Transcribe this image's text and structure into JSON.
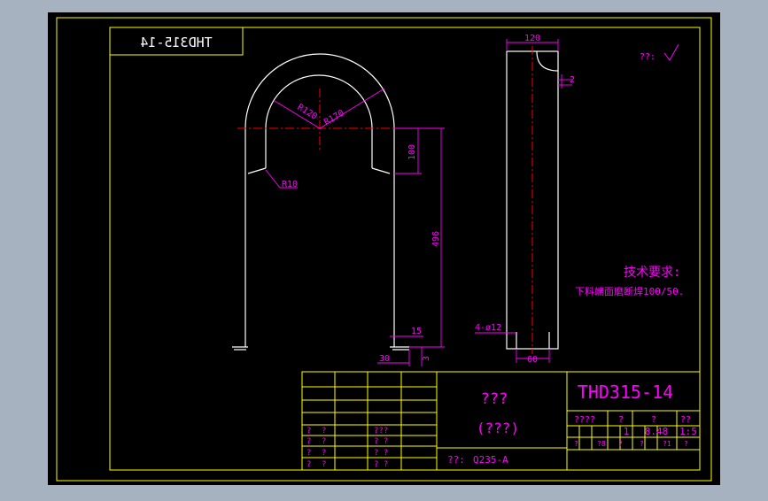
{
  "colors": {
    "background": "#a6b2c0",
    "canvas": "#000000",
    "frame": "#ffff00",
    "part_line": "#ffffff",
    "dimension": "#ff00ff",
    "centerline": "#ff0000"
  },
  "drawing": {
    "mirrored_code": "THD315-14",
    "roughness_symbol": "??:",
    "dimensions": {
      "r120": "R120",
      "r170": "R170",
      "r10": "R10",
      "d100": "100",
      "d496": "496",
      "d15": "15",
      "d30": "30",
      "d3": "3",
      "d120": "120",
      "d2": "2",
      "d60": "60",
      "holes": "4-ø12"
    },
    "notes_title": "技术要求:",
    "notes_text": "下料端面磨断焊100/50."
  },
  "title_block": {
    "part_name": "???",
    "part_subtitle": "(???)",
    "drawing_number": "THD315-14",
    "material_label": "??:",
    "material_value": "Q235-A",
    "left_rows": [
      [
        "?",
        "?",
        "?",
        "?",
        "?"
      ],
      [
        "?",
        "?",
        "?",
        "?",
        "?"
      ],
      [
        "?",
        "?",
        "?",
        "?",
        "?"
      ],
      [
        "?",
        "?",
        "?",
        "?",
        "?"
      ]
    ],
    "left_row_texts": [
      {
        "a": "?",
        "b": "?",
        "c": "???"
      },
      {
        "a": "?",
        "b": "?",
        "c": "? ?"
      },
      {
        "a": "?",
        "b": "?",
        "c": "? ?"
      },
      {
        "a": "?",
        "b": "?",
        "c": "? ?"
      }
    ],
    "header_labels": [
      "????",
      "?",
      "?",
      "??"
    ],
    "values": {
      "count": "1",
      "weight": "8.48",
      "scale": "1:5"
    },
    "footer_labels": [
      "?",
      "?8",
      "?",
      "?",
      "?1",
      "?"
    ]
  }
}
